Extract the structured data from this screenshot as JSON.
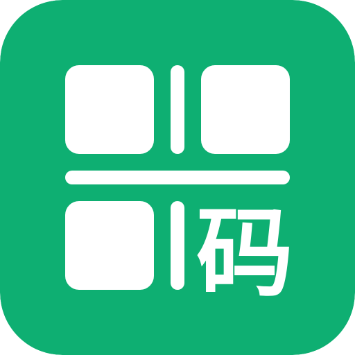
{
  "app_icon": {
    "glyph": "码",
    "icon_name": "qr-code-app-icon",
    "colors": {
      "tile": "#0eaf72",
      "foreground": "#ffffff"
    }
  }
}
